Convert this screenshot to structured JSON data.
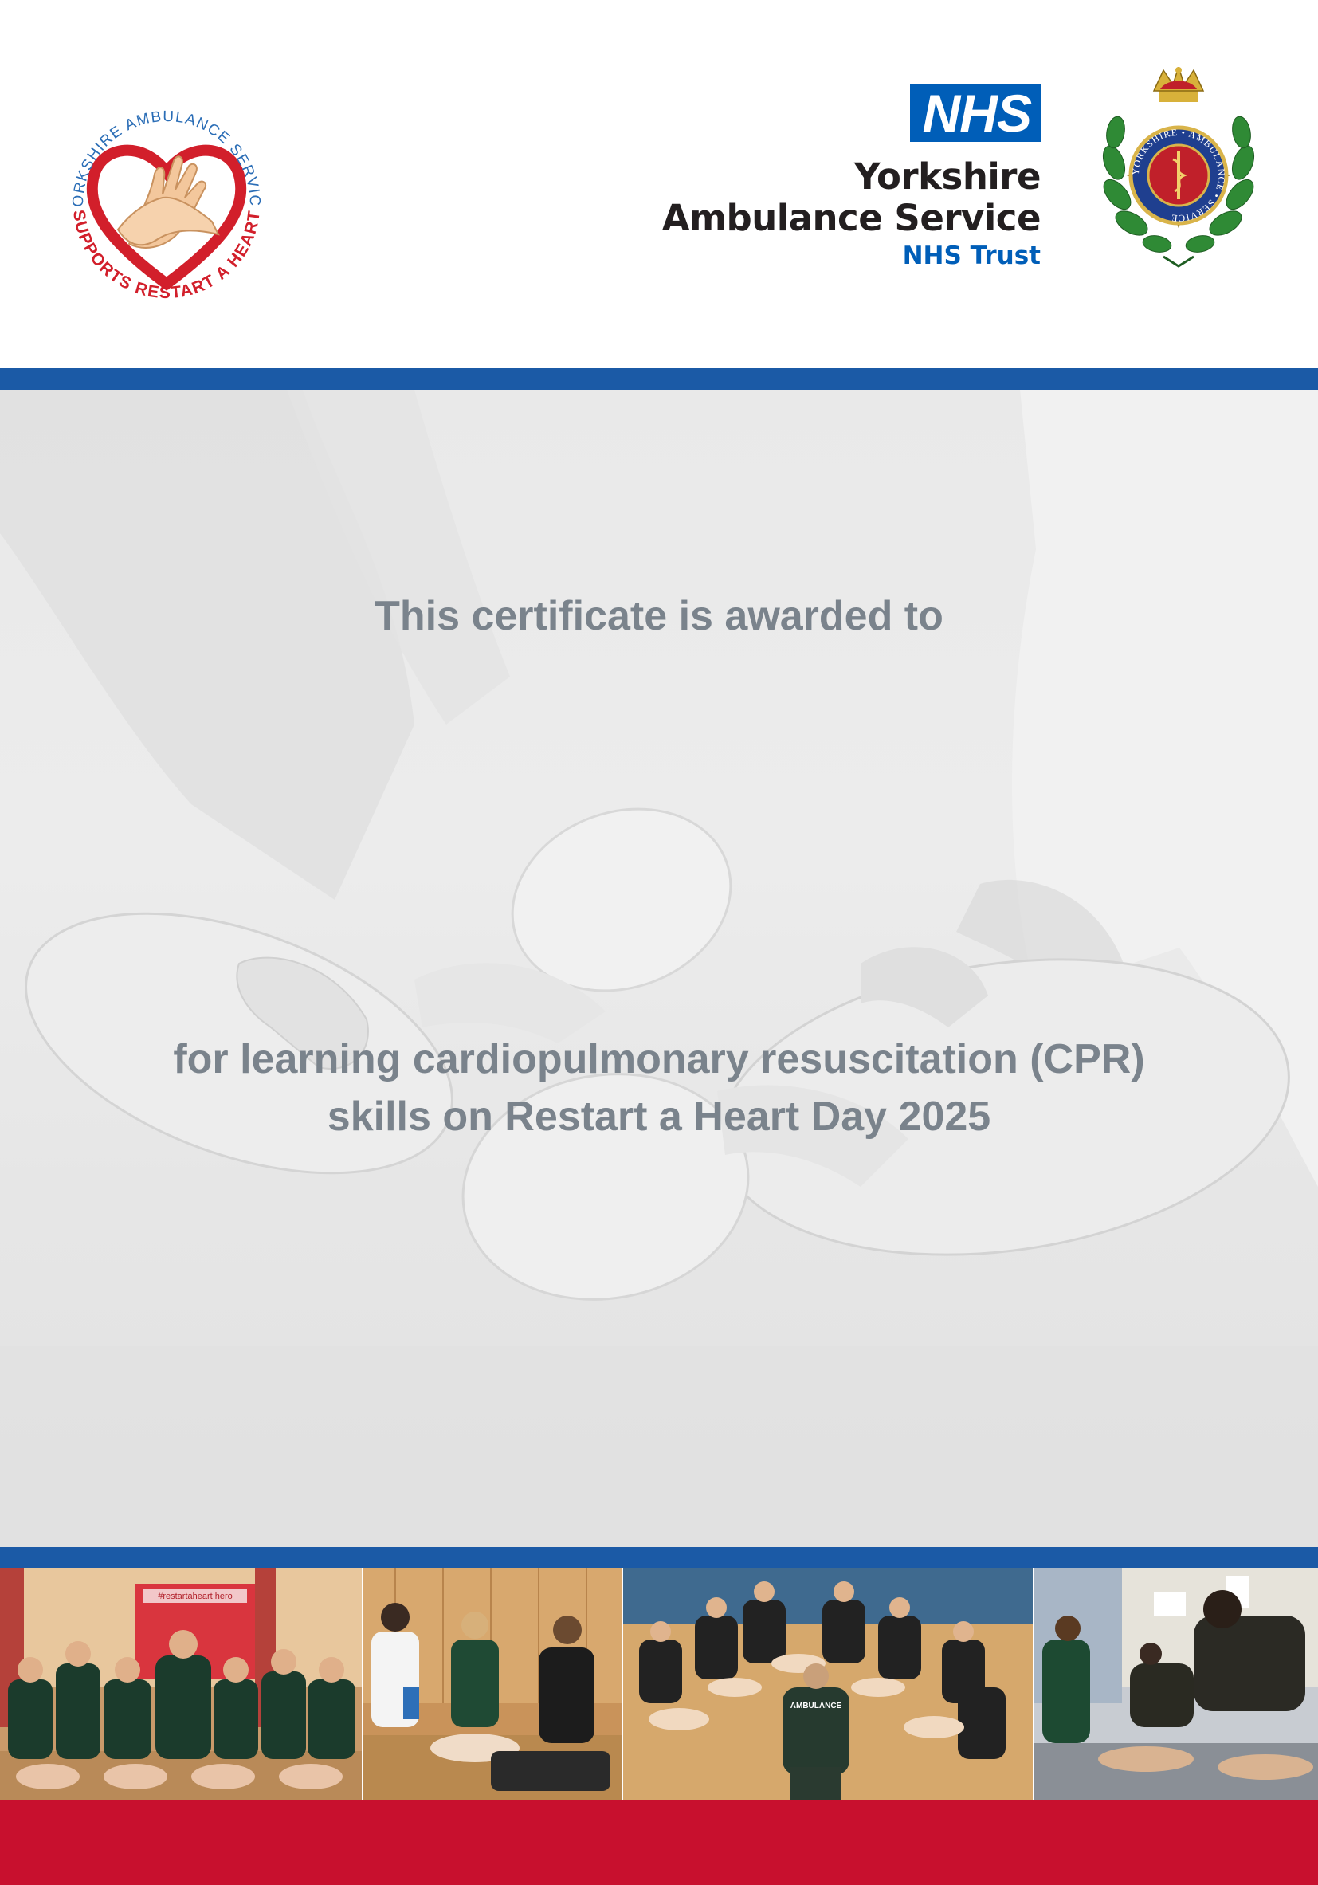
{
  "header": {
    "restart_logo": {
      "arc_top_text": "YORKSHIRE AMBULANCE SERVICE",
      "arc_bottom_text": "SUPPORTS RESTART A HEART",
      "icon": "heart-hands-icon"
    },
    "nhs": {
      "badge": "NHS",
      "org_line_1": "Yorkshire",
      "org_line_2": "Ambulance Service",
      "trust": "NHS Trust"
    },
    "crest": {
      "ring_text": "YORKSHIRE • AMBULANCE • SERVICE",
      "icon": "ambulance-crest-icon"
    }
  },
  "certificate": {
    "awarded_to": "This certificate is awarded to",
    "reason_line_1": "for learning cardiopulmonary resuscitation (CPR)",
    "reason_line_2": "skills on Restart a Heart Day 2025"
  },
  "photos": [
    {
      "name": "team-photo",
      "banner_text": "#restartaheart hero"
    },
    {
      "name": "school-cpr-photo"
    },
    {
      "name": "circle-training-photo",
      "vest_text": "AMBULANCE"
    },
    {
      "name": "office-cpr-photo"
    }
  ],
  "colors": {
    "nhs_blue": "#005eb8",
    "band_blue": "#1b5aa6",
    "footer_red": "#c8102e",
    "text_grey": "#7a838c"
  }
}
